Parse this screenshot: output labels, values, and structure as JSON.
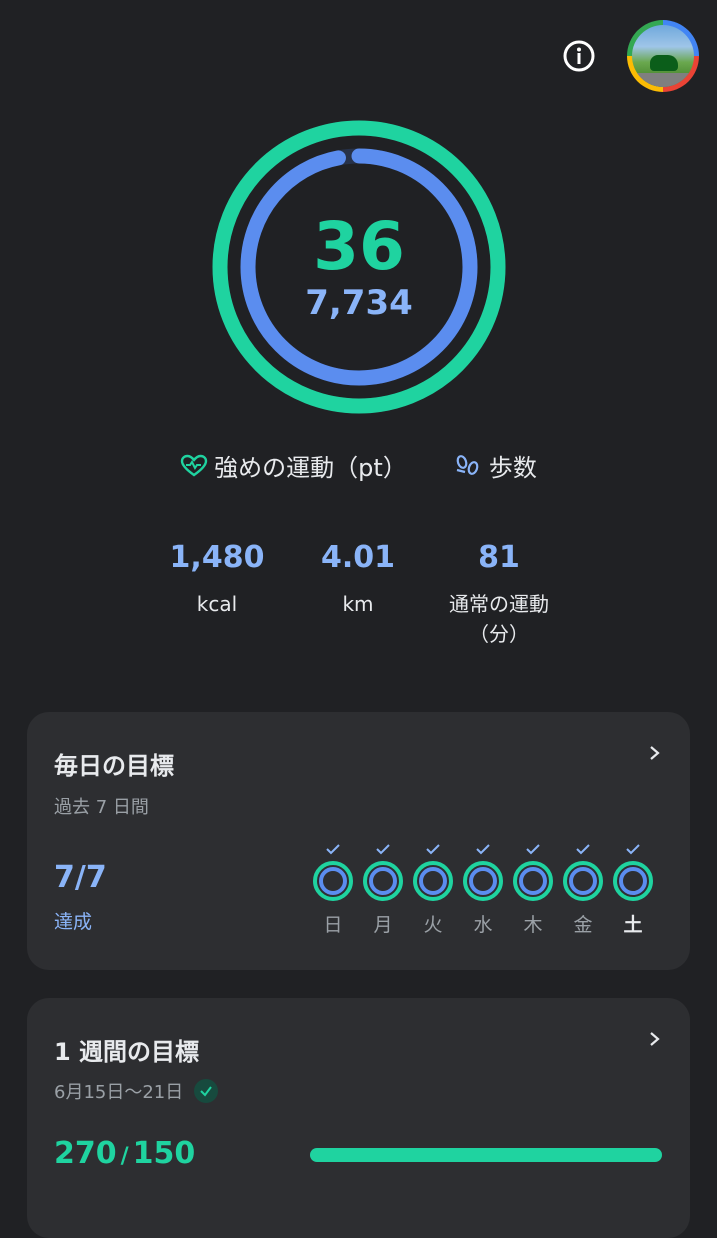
{
  "header": {
    "info_icon": "info-icon",
    "avatar_icon": "profile-avatar"
  },
  "rings": {
    "heart_points": "36",
    "steps": "7,734",
    "heart_progress": 1.0,
    "steps_progress": 0.97
  },
  "legend": {
    "heart_label": "強めの運動（pt）",
    "steps_label": "歩数",
    "heart_icon": "heart-icon",
    "steps_icon": "footsteps-icon"
  },
  "stats": [
    {
      "value": "1,480",
      "label": "kcal"
    },
    {
      "value": "4.01",
      "label": "km"
    },
    {
      "value": "81",
      "label": "通常の運動",
      "label2": "（分）"
    }
  ],
  "daily_goal": {
    "title": "毎日の目標",
    "subtitle": "過去 7 日間",
    "achieved": "7/7",
    "achieved_label": "達成",
    "days": [
      "日",
      "月",
      "火",
      "水",
      "木",
      "金",
      "土"
    ]
  },
  "weekly_goal": {
    "title": "1 週間の目標",
    "date_range": "6月15日〜21日",
    "current": "270",
    "separator": "/",
    "target": "150",
    "progress": 1.0
  },
  "colors": {
    "green": "#1fd3a0",
    "blue": "#8ab4f8",
    "ring_blue": "#5b8def"
  }
}
